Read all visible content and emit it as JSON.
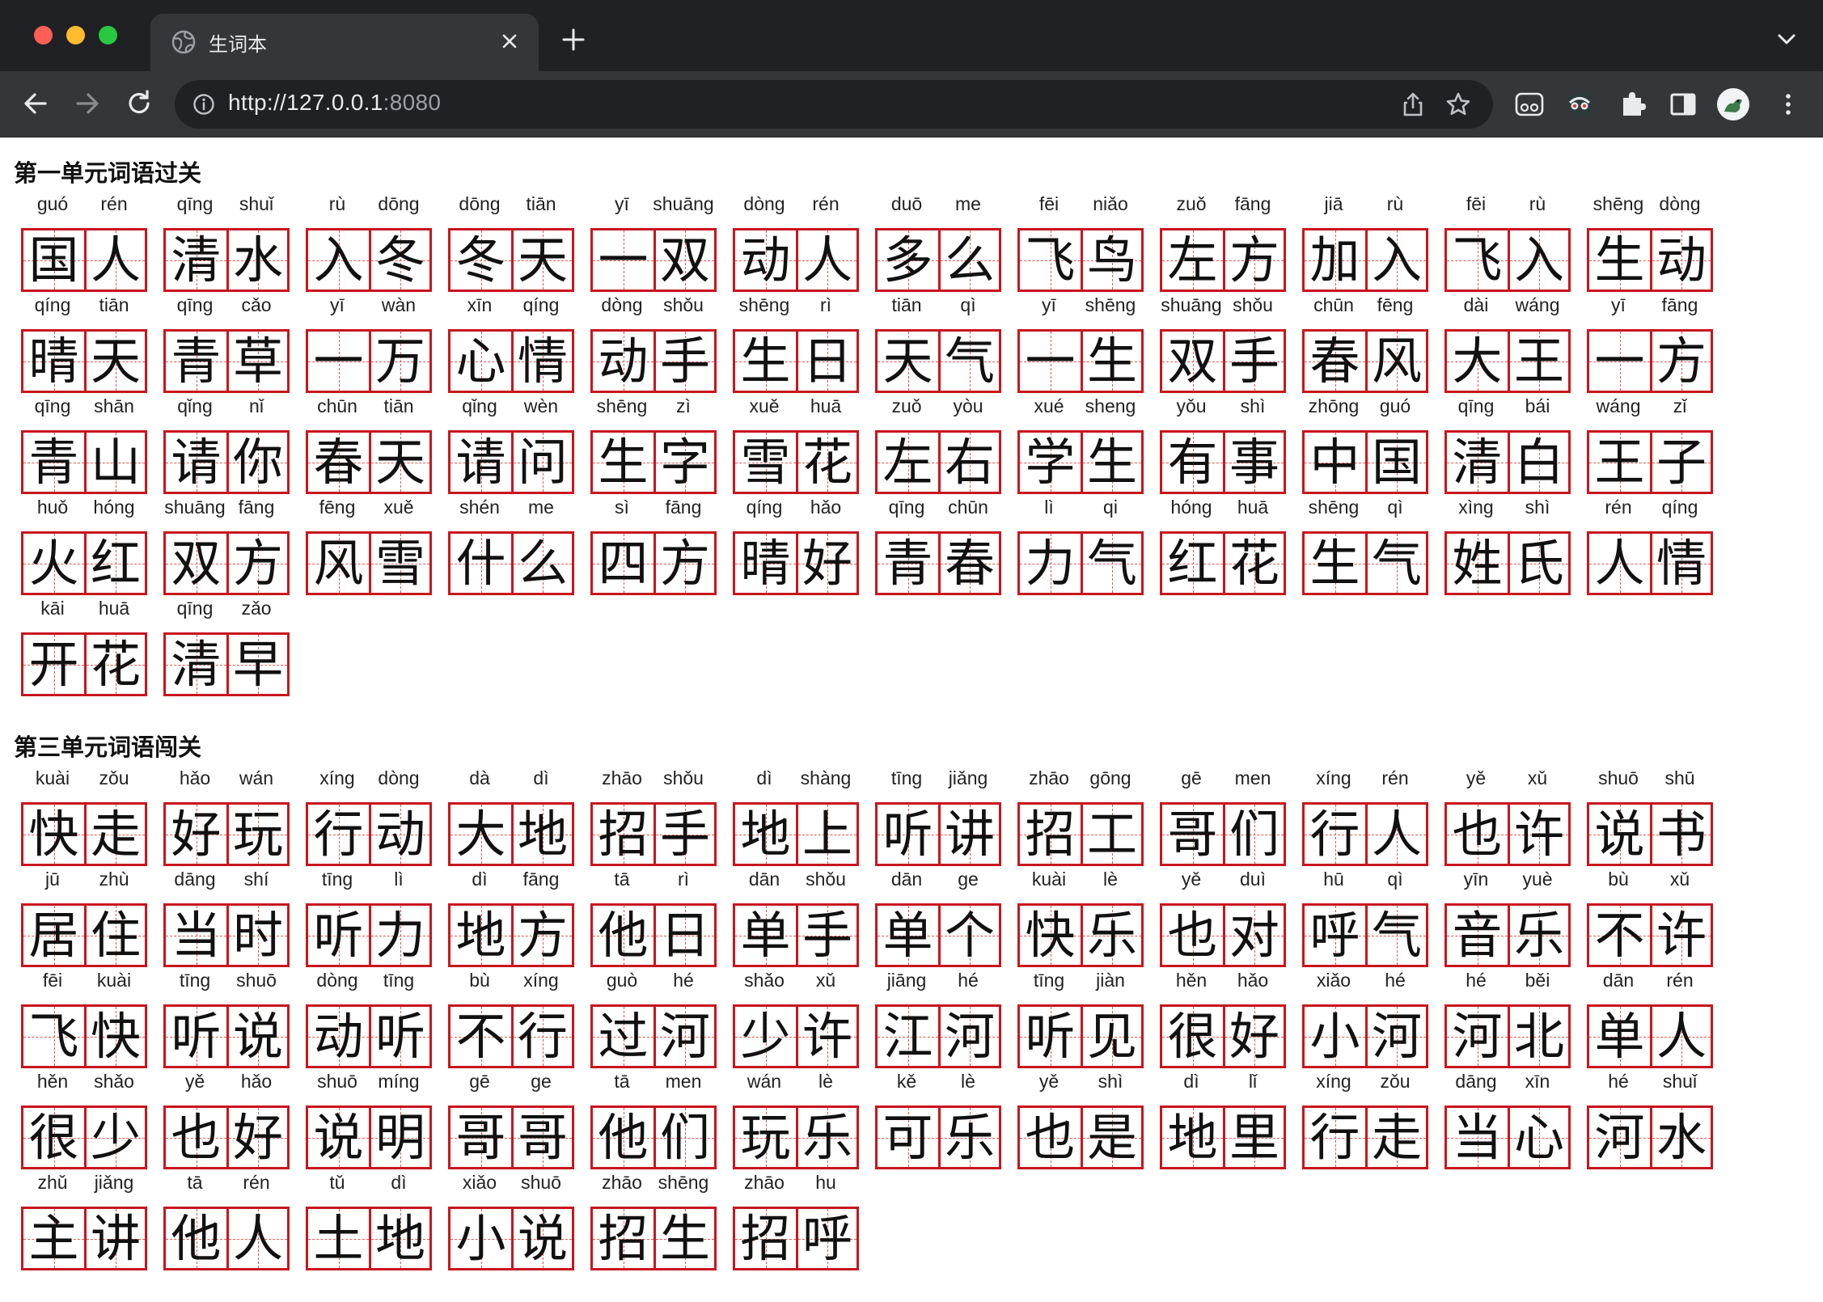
{
  "browser": {
    "tab_title": "生词本",
    "url_host": "http://127.0.0.1",
    "url_port": ":8080",
    "icons": [
      "globe-icon",
      "close-icon",
      "plus-icon",
      "chevron-down-icon",
      "back-icon",
      "forward-icon",
      "reload-icon",
      "info-icon",
      "share-icon",
      "star-icon",
      "extension-icon",
      "puzzle-icon",
      "sidebar-icon",
      "avatar",
      "more-icon"
    ],
    "colors": {
      "tab_strip": "#202124",
      "toolbar": "#35363a",
      "grid_red": "#c8161d"
    }
  },
  "sections": [
    {
      "title": "第一单元词语过关",
      "words": [
        {
          "chars": [
            "国",
            "人"
          ],
          "pinyin": [
            "guó",
            "rén"
          ]
        },
        {
          "chars": [
            "清",
            "水"
          ],
          "pinyin": [
            "qīng",
            "shuǐ"
          ]
        },
        {
          "chars": [
            "入",
            "冬"
          ],
          "pinyin": [
            "rù",
            "dōng"
          ]
        },
        {
          "chars": [
            "冬",
            "天"
          ],
          "pinyin": [
            "dōng",
            "tiān"
          ]
        },
        {
          "chars": [
            "一",
            "双"
          ],
          "pinyin": [
            "yī",
            "shuāng"
          ]
        },
        {
          "chars": [
            "动",
            "人"
          ],
          "pinyin": [
            "dòng",
            "rén"
          ]
        },
        {
          "chars": [
            "多",
            "么"
          ],
          "pinyin": [
            "duō",
            "me"
          ]
        },
        {
          "chars": [
            "飞",
            "鸟"
          ],
          "pinyin": [
            "fēi",
            "niǎo"
          ]
        },
        {
          "chars": [
            "左",
            "方"
          ],
          "pinyin": [
            "zuǒ",
            "fāng"
          ]
        },
        {
          "chars": [
            "加",
            "入"
          ],
          "pinyin": [
            "jiā",
            "rù"
          ]
        },
        {
          "chars": [
            "飞",
            "入"
          ],
          "pinyin": [
            "fēi",
            "rù"
          ]
        },
        {
          "chars": [
            "生",
            "动"
          ],
          "pinyin": [
            "shēng",
            "dòng"
          ]
        },
        {
          "chars": [
            "晴",
            "天"
          ],
          "pinyin": [
            "qíng",
            "tiān"
          ]
        },
        {
          "chars": [
            "青",
            "草"
          ],
          "pinyin": [
            "qīng",
            "cǎo"
          ]
        },
        {
          "chars": [
            "一",
            "万"
          ],
          "pinyin": [
            "yī",
            "wàn"
          ]
        },
        {
          "chars": [
            "心",
            "情"
          ],
          "pinyin": [
            "xīn",
            "qíng"
          ]
        },
        {
          "chars": [
            "动",
            "手"
          ],
          "pinyin": [
            "dòng",
            "shǒu"
          ]
        },
        {
          "chars": [
            "生",
            "日"
          ],
          "pinyin": [
            "shēng",
            "rì"
          ]
        },
        {
          "chars": [
            "天",
            "气"
          ],
          "pinyin": [
            "tiān",
            "qì"
          ]
        },
        {
          "chars": [
            "一",
            "生"
          ],
          "pinyin": [
            "yī",
            "shēng"
          ]
        },
        {
          "chars": [
            "双",
            "手"
          ],
          "pinyin": [
            "shuāng",
            "shǒu"
          ]
        },
        {
          "chars": [
            "春",
            "风"
          ],
          "pinyin": [
            "chūn",
            "fēng"
          ]
        },
        {
          "chars": [
            "大",
            "王"
          ],
          "pinyin": [
            "dài",
            "wáng"
          ]
        },
        {
          "chars": [
            "一",
            "方"
          ],
          "pinyin": [
            "yī",
            "fāng"
          ]
        },
        {
          "chars": [
            "青",
            "山"
          ],
          "pinyin": [
            "qīng",
            "shān"
          ]
        },
        {
          "chars": [
            "请",
            "你"
          ],
          "pinyin": [
            "qǐng",
            "nǐ"
          ]
        },
        {
          "chars": [
            "春",
            "天"
          ],
          "pinyin": [
            "chūn",
            "tiān"
          ]
        },
        {
          "chars": [
            "请",
            "问"
          ],
          "pinyin": [
            "qǐng",
            "wèn"
          ]
        },
        {
          "chars": [
            "生",
            "字"
          ],
          "pinyin": [
            "shēng",
            "zì"
          ]
        },
        {
          "chars": [
            "雪",
            "花"
          ],
          "pinyin": [
            "xuě",
            "huā"
          ]
        },
        {
          "chars": [
            "左",
            "右"
          ],
          "pinyin": [
            "zuǒ",
            "yòu"
          ]
        },
        {
          "chars": [
            "学",
            "生"
          ],
          "pinyin": [
            "xué",
            "sheng"
          ]
        },
        {
          "chars": [
            "有",
            "事"
          ],
          "pinyin": [
            "yǒu",
            "shì"
          ]
        },
        {
          "chars": [
            "中",
            "国"
          ],
          "pinyin": [
            "zhōng",
            "guó"
          ]
        },
        {
          "chars": [
            "清",
            "白"
          ],
          "pinyin": [
            "qīng",
            "bái"
          ]
        },
        {
          "chars": [
            "王",
            "子"
          ],
          "pinyin": [
            "wáng",
            "zǐ"
          ]
        },
        {
          "chars": [
            "火",
            "红"
          ],
          "pinyin": [
            "huǒ",
            "hóng"
          ]
        },
        {
          "chars": [
            "双",
            "方"
          ],
          "pinyin": [
            "shuāng",
            "fāng"
          ]
        },
        {
          "chars": [
            "风",
            "雪"
          ],
          "pinyin": [
            "fēng",
            "xuě"
          ]
        },
        {
          "chars": [
            "什",
            "么"
          ],
          "pinyin": [
            "shén",
            "me"
          ]
        },
        {
          "chars": [
            "四",
            "方"
          ],
          "pinyin": [
            "sì",
            "fāng"
          ]
        },
        {
          "chars": [
            "晴",
            "好"
          ],
          "pinyin": [
            "qíng",
            "hǎo"
          ]
        },
        {
          "chars": [
            "青",
            "春"
          ],
          "pinyin": [
            "qīng",
            "chūn"
          ]
        },
        {
          "chars": [
            "力",
            "气"
          ],
          "pinyin": [
            "lì",
            "qi"
          ]
        },
        {
          "chars": [
            "红",
            "花"
          ],
          "pinyin": [
            "hóng",
            "huā"
          ]
        },
        {
          "chars": [
            "生",
            "气"
          ],
          "pinyin": [
            "shēng",
            "qì"
          ]
        },
        {
          "chars": [
            "姓",
            "氏"
          ],
          "pinyin": [
            "xìng",
            "shì"
          ]
        },
        {
          "chars": [
            "人",
            "情"
          ],
          "pinyin": [
            "rén",
            "qíng"
          ]
        },
        {
          "chars": [
            "开",
            "花"
          ],
          "pinyin": [
            "kāi",
            "huā"
          ]
        },
        {
          "chars": [
            "清",
            "早"
          ],
          "pinyin": [
            "qīng",
            "zǎo"
          ]
        }
      ]
    },
    {
      "title": "第三单元词语闯关",
      "words": [
        {
          "chars": [
            "快",
            "走"
          ],
          "pinyin": [
            "kuài",
            "zǒu"
          ]
        },
        {
          "chars": [
            "好",
            "玩"
          ],
          "pinyin": [
            "hǎo",
            "wán"
          ]
        },
        {
          "chars": [
            "行",
            "动"
          ],
          "pinyin": [
            "xíng",
            "dòng"
          ]
        },
        {
          "chars": [
            "大",
            "地"
          ],
          "pinyin": [
            "dà",
            "dì"
          ]
        },
        {
          "chars": [
            "招",
            "手"
          ],
          "pinyin": [
            "zhāo",
            "shǒu"
          ]
        },
        {
          "chars": [
            "地",
            "上"
          ],
          "pinyin": [
            "dì",
            "shàng"
          ]
        },
        {
          "chars": [
            "听",
            "讲"
          ],
          "pinyin": [
            "tīng",
            "jiǎng"
          ]
        },
        {
          "chars": [
            "招",
            "工"
          ],
          "pinyin": [
            "zhāo",
            "gōng"
          ]
        },
        {
          "chars": [
            "哥",
            "们"
          ],
          "pinyin": [
            "gē",
            "men"
          ]
        },
        {
          "chars": [
            "行",
            "人"
          ],
          "pinyin": [
            "xíng",
            "rén"
          ]
        },
        {
          "chars": [
            "也",
            "许"
          ],
          "pinyin": [
            "yě",
            "xǔ"
          ]
        },
        {
          "chars": [
            "说",
            "书"
          ],
          "pinyin": [
            "shuō",
            "shū"
          ]
        },
        {
          "chars": [
            "居",
            "住"
          ],
          "pinyin": [
            "jū",
            "zhù"
          ]
        },
        {
          "chars": [
            "当",
            "时"
          ],
          "pinyin": [
            "dāng",
            "shí"
          ]
        },
        {
          "chars": [
            "听",
            "力"
          ],
          "pinyin": [
            "tīng",
            "lì"
          ]
        },
        {
          "chars": [
            "地",
            "方"
          ],
          "pinyin": [
            "dì",
            "fāng"
          ]
        },
        {
          "chars": [
            "他",
            "日"
          ],
          "pinyin": [
            "tā",
            "rì"
          ]
        },
        {
          "chars": [
            "单",
            "手"
          ],
          "pinyin": [
            "dān",
            "shǒu"
          ]
        },
        {
          "chars": [
            "单",
            "个"
          ],
          "pinyin": [
            "dān",
            "ge"
          ]
        },
        {
          "chars": [
            "快",
            "乐"
          ],
          "pinyin": [
            "kuài",
            "lè"
          ]
        },
        {
          "chars": [
            "也",
            "对"
          ],
          "pinyin": [
            "yě",
            "duì"
          ]
        },
        {
          "chars": [
            "呼",
            "气"
          ],
          "pinyin": [
            "hū",
            "qì"
          ]
        },
        {
          "chars": [
            "音",
            "乐"
          ],
          "pinyin": [
            "yīn",
            "yuè"
          ]
        },
        {
          "chars": [
            "不",
            "许"
          ],
          "pinyin": [
            "bù",
            "xǔ"
          ]
        },
        {
          "chars": [
            "飞",
            "快"
          ],
          "pinyin": [
            "fēi",
            "kuài"
          ]
        },
        {
          "chars": [
            "听",
            "说"
          ],
          "pinyin": [
            "tīng",
            "shuō"
          ]
        },
        {
          "chars": [
            "动",
            "听"
          ],
          "pinyin": [
            "dòng",
            "tīng"
          ]
        },
        {
          "chars": [
            "不",
            "行"
          ],
          "pinyin": [
            "bù",
            "xíng"
          ]
        },
        {
          "chars": [
            "过",
            "河"
          ],
          "pinyin": [
            "guò",
            "hé"
          ]
        },
        {
          "chars": [
            "少",
            "许"
          ],
          "pinyin": [
            "shǎo",
            "xǔ"
          ]
        },
        {
          "chars": [
            "江",
            "河"
          ],
          "pinyin": [
            "jiāng",
            "hé"
          ]
        },
        {
          "chars": [
            "听",
            "见"
          ],
          "pinyin": [
            "tīng",
            "jiàn"
          ]
        },
        {
          "chars": [
            "很",
            "好"
          ],
          "pinyin": [
            "hěn",
            "hǎo"
          ]
        },
        {
          "chars": [
            "小",
            "河"
          ],
          "pinyin": [
            "xiǎo",
            "hé"
          ]
        },
        {
          "chars": [
            "河",
            "北"
          ],
          "pinyin": [
            "hé",
            "běi"
          ]
        },
        {
          "chars": [
            "单",
            "人"
          ],
          "pinyin": [
            "dān",
            "rén"
          ]
        },
        {
          "chars": [
            "很",
            "少"
          ],
          "pinyin": [
            "hěn",
            "shǎo"
          ]
        },
        {
          "chars": [
            "也",
            "好"
          ],
          "pinyin": [
            "yě",
            "hǎo"
          ]
        },
        {
          "chars": [
            "说",
            "明"
          ],
          "pinyin": [
            "shuō",
            "míng"
          ]
        },
        {
          "chars": [
            "哥",
            "哥"
          ],
          "pinyin": [
            "gē",
            "ge"
          ]
        },
        {
          "chars": [
            "他",
            "们"
          ],
          "pinyin": [
            "tā",
            "men"
          ]
        },
        {
          "chars": [
            "玩",
            "乐"
          ],
          "pinyin": [
            "wán",
            "lè"
          ]
        },
        {
          "chars": [
            "可",
            "乐"
          ],
          "pinyin": [
            "kě",
            "lè"
          ]
        },
        {
          "chars": [
            "也",
            "是"
          ],
          "pinyin": [
            "yě",
            "shì"
          ]
        },
        {
          "chars": [
            "地",
            "里"
          ],
          "pinyin": [
            "dì",
            "lǐ"
          ]
        },
        {
          "chars": [
            "行",
            "走"
          ],
          "pinyin": [
            "xíng",
            "zǒu"
          ]
        },
        {
          "chars": [
            "当",
            "心"
          ],
          "pinyin": [
            "dāng",
            "xīn"
          ]
        },
        {
          "chars": [
            "河",
            "水"
          ],
          "pinyin": [
            "hé",
            "shuǐ"
          ]
        },
        {
          "chars": [
            "主",
            "讲"
          ],
          "pinyin": [
            "zhǔ",
            "jiǎng"
          ]
        },
        {
          "chars": [
            "他",
            "人"
          ],
          "pinyin": [
            "tā",
            "rén"
          ]
        },
        {
          "chars": [
            "土",
            "地"
          ],
          "pinyin": [
            "tǔ",
            "dì"
          ]
        },
        {
          "chars": [
            "小",
            "说"
          ],
          "pinyin": [
            "xiǎo",
            "shuō"
          ]
        },
        {
          "chars": [
            "招",
            "生"
          ],
          "pinyin": [
            "zhāo",
            "shēng"
          ]
        },
        {
          "chars": [
            "招",
            "呼"
          ],
          "pinyin": [
            "zhāo",
            "hu"
          ]
        }
      ]
    }
  ]
}
